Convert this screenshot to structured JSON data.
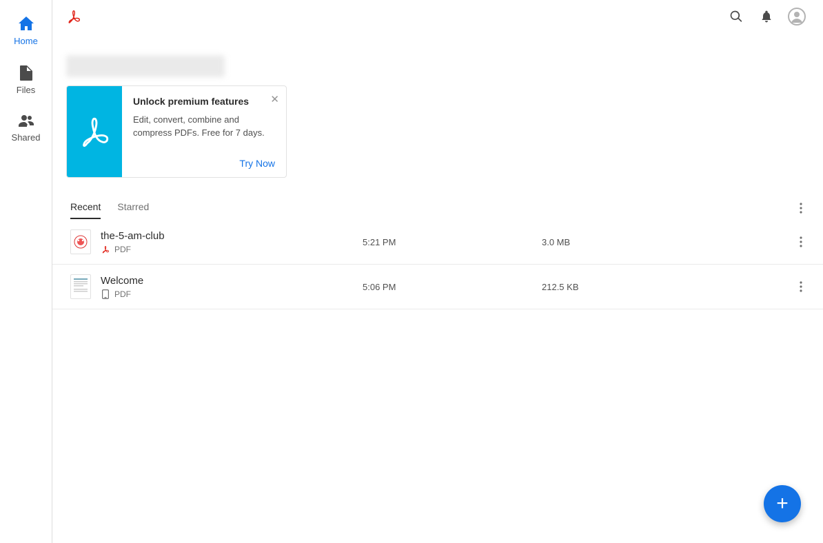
{
  "sidebar": {
    "items": [
      {
        "label": "Home",
        "active": true
      },
      {
        "label": "Files",
        "active": false
      },
      {
        "label": "Shared",
        "active": false
      }
    ]
  },
  "promo": {
    "title": "Unlock premium features",
    "body": "Edit, convert, combine and compress PDFs. Free for 7 days.",
    "cta": "Try Now"
  },
  "tabs": [
    {
      "label": "Recent",
      "active": true
    },
    {
      "label": "Starred",
      "active": false
    }
  ],
  "files": [
    {
      "name": "the-5-am-club",
      "type": "PDF",
      "time": "5:21 PM",
      "size": "3.0 MB",
      "source": "pdf"
    },
    {
      "name": "Welcome",
      "type": "PDF",
      "time": "5:06 PM",
      "size": "212.5 KB",
      "source": "device"
    }
  ],
  "colors": {
    "accent": "#1473e6",
    "promoBg": "#00b5e2",
    "adobeRed": "#e1251b"
  }
}
